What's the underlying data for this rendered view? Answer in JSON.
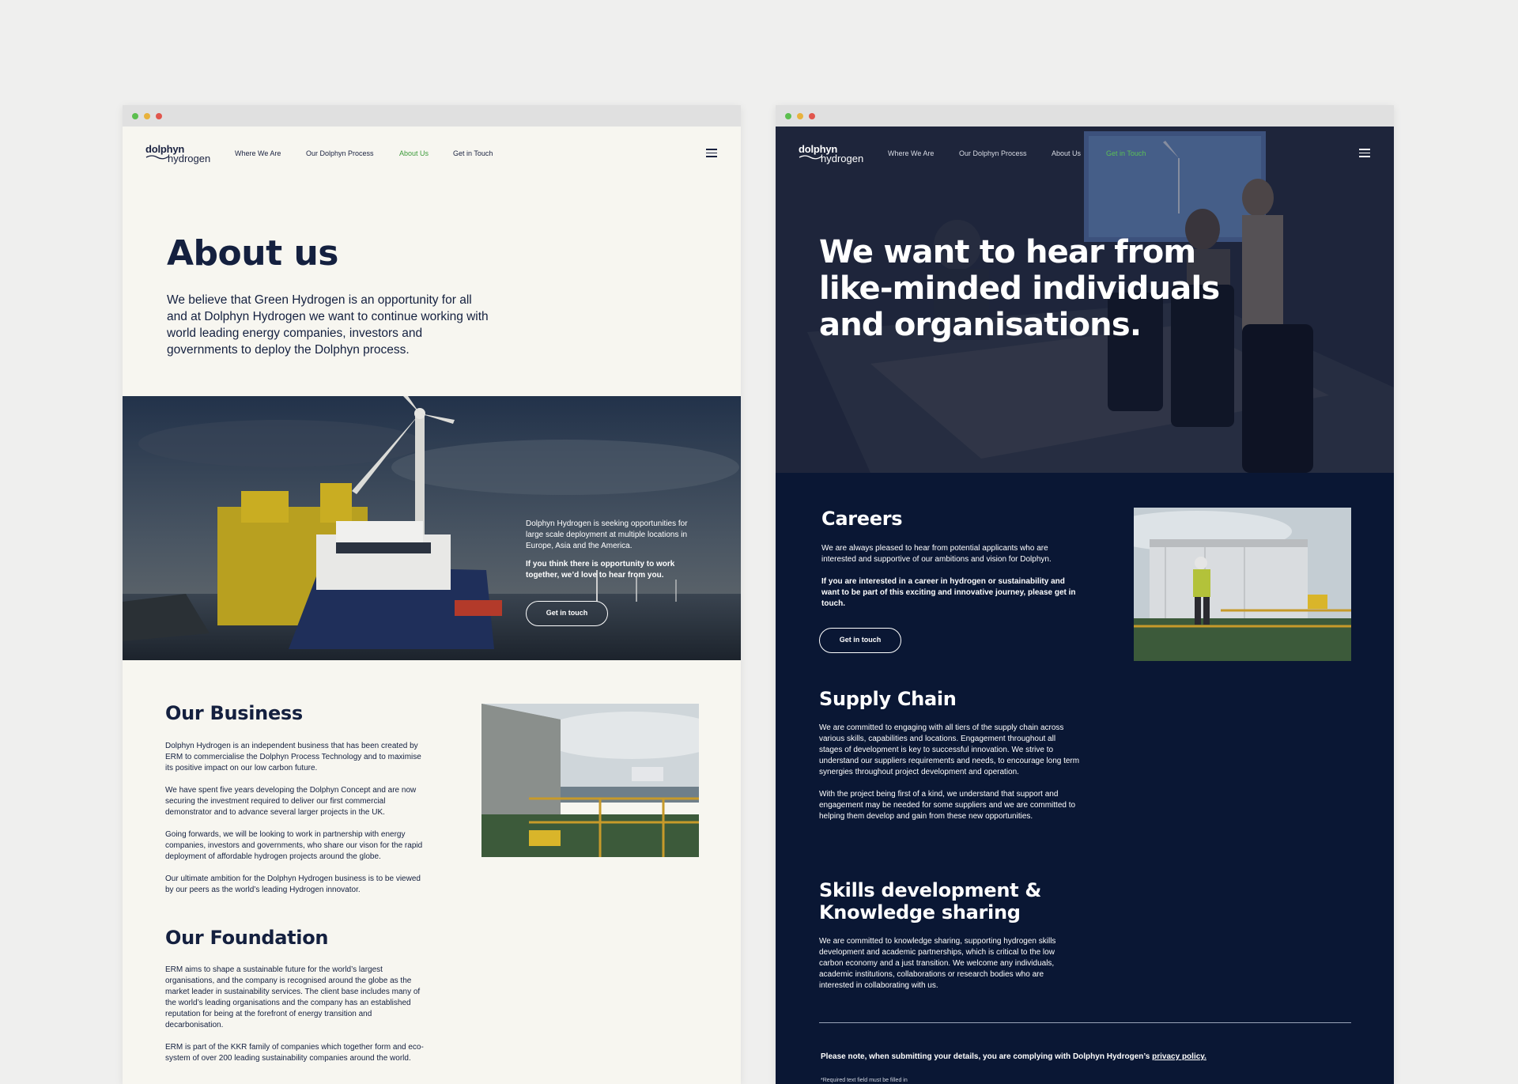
{
  "left_page": {
    "logo": {
      "top": "dolphyn",
      "bottom": "hydrogen"
    },
    "nav": [
      {
        "label": "Where We Are"
      },
      {
        "label": "Our Dolphyn Process"
      },
      {
        "label": "About Us"
      },
      {
        "label": "Get in Touch"
      }
    ],
    "active_nav": "About Us",
    "title": "About us",
    "intro": "We believe that Green Hydrogen is an opportunity for all and at Dolphyn Hydrogen we want to continue working with world leading energy companies, investors and governments to deploy the Dolphyn process.",
    "hero": {
      "text1": "Dolphyn Hydrogen is seeking opportunities for large scale deployment at multiple locations in Europe, Asia and the America.",
      "text2": "If you think there is opportunity to work together, we’d love to hear from you.",
      "button": "Get in touch"
    },
    "business": {
      "title": "Our Business",
      "paragraphs": [
        "Dolphyn Hydrogen is an independent business that has been created by ERM to commercialise the Dolphyn Process Technology and to maximise its positive impact on our low carbon future.",
        "We have spent five years developing the Dolphyn Concept and are now securing the investment required to deliver our first commercial demonstrator and to advance several larger projects in the UK.",
        "Going forwards, we will be looking to work in partnership with energy companies, investors and governments, who share our vison for the rapid deployment of affordable hydrogen projects around the globe.",
        "Our ultimate ambition for the Dolphyn Hydrogen business is to be viewed by our peers as the world’s leading Hydrogen innovator."
      ]
    },
    "foundation": {
      "title": "Our Foundation",
      "paragraphs": [
        "ERM aims to shape a sustainable future for the world’s largest organisations, and the company is recognised around the globe as the market leader in sustainability services. The client base includes many of the world’s leading organisations and the company has an established reputation for being at the forefront of energy transition and decarbonisation.",
        "ERM is part of the KKR family of companies which together form and eco-system of over 200 leading sustainability companies around the world."
      ]
    }
  },
  "right_page": {
    "logo": {
      "top": "dolphyn",
      "bottom": "hydrogen"
    },
    "nav": [
      {
        "label": "Where We Are"
      },
      {
        "label": "Our Dolphyn Process"
      },
      {
        "label": "About Us"
      },
      {
        "label": "Get in Touch"
      }
    ],
    "active_nav": "Get in Touch",
    "headline": "We want to hear from like-minded individuals and organisations.",
    "careers": {
      "title": "Careers",
      "p1": "We are always pleased to hear from potential applicants who are interested and supportive of our ambitions and vision for Dolphyn.",
      "p2": "If you are interested in a career in hydrogen or sustainability and want to be part of this exciting and innovative journey, please get in touch.",
      "button": "Get in touch"
    },
    "supply": {
      "title": "Supply Chain",
      "p1": "We are committed to engaging with all tiers of the supply chain across various skills, capabilities and locations. Engagement throughout all stages of development is key to successful innovation. We strive to understand our suppliers requirements and needs, to encourage long term synergies throughout project development and operation.",
      "p2": "With the project being first of a kind, we understand that support and engagement may be needed for some suppliers and we are committed to helping them develop and gain from these new opportunities."
    },
    "skills": {
      "title_line1": "Skills development &",
      "title_line2": "Knowledge sharing",
      "p1": "We are committed to knowledge sharing, supporting hydrogen skills development and academic partnerships, which is critical to the low carbon economy and a just transition. We welcome any individuals, academic institutions, collaborations or research bodies who are interested in collaborating with us."
    },
    "note": {
      "text": "Please note, when submitting your details, you are complying with Dolphyn Hydrogen’s ",
      "link": "privacy policy."
    },
    "required": "*Required text field must be filled in"
  },
  "colors": {
    "navy": "#0a1734",
    "cream": "#f7f6f0",
    "accent_green": "#3d9b3a"
  }
}
